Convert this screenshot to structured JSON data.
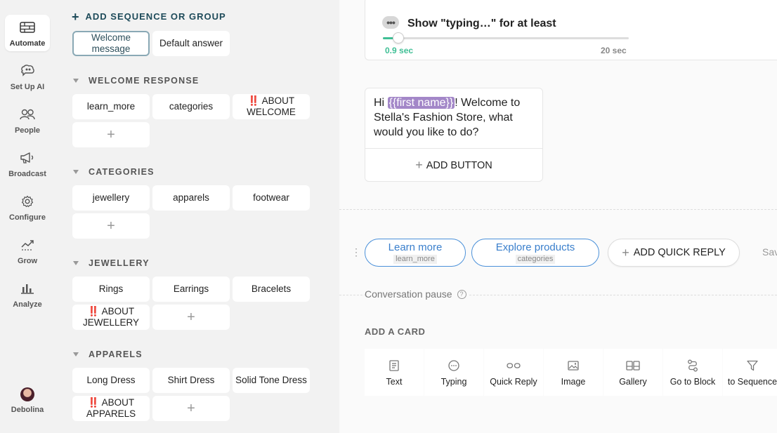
{
  "nav": {
    "items": [
      {
        "label": "Automate",
        "icon": "automate-icon",
        "active": true
      },
      {
        "label": "Set Up AI",
        "icon": "ai-brain-icon"
      },
      {
        "label": "People",
        "icon": "people-icon"
      },
      {
        "label": "Broadcast",
        "icon": "megaphone-icon"
      },
      {
        "label": "Configure",
        "icon": "gear-icon"
      },
      {
        "label": "Grow",
        "icon": "growth-chart-icon"
      },
      {
        "label": "Analyze",
        "icon": "bar-chart-icon"
      }
    ],
    "user": {
      "name": "Debolina",
      "icon": "avatar"
    }
  },
  "tree": {
    "add_label": "ADD SEQUENCE OR GROUP",
    "top_blocks": [
      "Welcome message",
      "Default answer"
    ],
    "groups": [
      {
        "title": "WELCOME RESPONSE",
        "blocks": [
          "learn_more",
          "categories",
          "‼️ ABOUT WELCOME"
        ]
      },
      {
        "title": "CATEGORIES",
        "blocks": [
          "jewellery",
          "apparels",
          "footwear"
        ]
      },
      {
        "title": "JEWELLERY",
        "blocks": [
          "Rings",
          "Earrings",
          "Bracelets",
          "‼️ ABOUT JEWELLERY"
        ]
      },
      {
        "title": "APPARELS",
        "blocks": [
          "Long Dress",
          "Shirt Dress",
          "Solid Tone Dress",
          "‼️ ABOUT APPARELS"
        ]
      }
    ],
    "add_block_symbol": "+"
  },
  "editor": {
    "typing": {
      "title": "Show \"typing…\" for at least",
      "min_label": "0.9 sec",
      "max_label": "20 sec",
      "value_fraction": 0.045,
      "dots": "•••"
    },
    "text_card": {
      "prefix": "Hi ",
      "variable": "{{first name}}",
      "suffix": "! Welcome to Stella's Fashion Store, what would you like to do?",
      "add_button_label": "ADD BUTTON"
    },
    "quick_replies": [
      {
        "title": "Learn more",
        "block": "learn_more"
      },
      {
        "title": "Explore products",
        "block": "categories"
      }
    ],
    "add_quick_reply_label": "ADD QUICK REPLY",
    "save_cut_label": "Sav",
    "pause_label": "Conversation pause",
    "pause_help": "?",
    "add_card_title": "ADD A CARD",
    "tools": [
      {
        "label": "Text",
        "icon": "text-card-icon"
      },
      {
        "label": "Typing",
        "icon": "typing-icon"
      },
      {
        "label": "Quick Reply",
        "icon": "quick-reply-icon"
      },
      {
        "label": "Image",
        "icon": "image-icon"
      },
      {
        "label": "Gallery",
        "icon": "gallery-icon"
      },
      {
        "label": "Go to Block",
        "icon": "go-to-block-icon"
      },
      {
        "label": "to Sequence",
        "icon": "filter-icon"
      }
    ]
  },
  "colors": {
    "accent_green": "#3fbf95",
    "quick_reply_blue": "#4a90d9",
    "variable_purple": "#a387c8",
    "group_title": "#1e4b5a"
  }
}
